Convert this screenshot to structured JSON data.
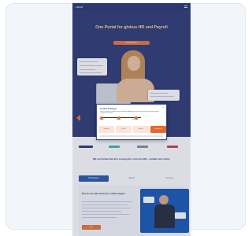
{
  "site": {
    "logo_text": "LOGO",
    "hero_title": "One Portal for globus HR und Payroll",
    "hero_cta_label": "Jetzt starten"
  },
  "modal": {
    "title": "Cookie Settings",
    "close_label": "×",
    "text": "We use cookies to improve your experience. Adjust your preferences below and choose which categories you allow.",
    "slider_labels": [
      "Essential",
      "Statistics",
      "Marketing"
    ],
    "buttons": [
      "Settings",
      "Reject",
      "Accept",
      "Accept all"
    ]
  },
  "section": {
    "title": "Mit uns finden Sie Ihre Lösung für Lohn und HR – einfach und sicher"
  },
  "tabs": [
    "HR-Software",
    "Payroll",
    "Services"
  ],
  "info": {
    "title": "Besser als alle anderen Lohnlösungen",
    "cta_label": "Mehr"
  },
  "colors": {
    "hero_bg": "#34417a",
    "accent": "#e87a3e",
    "tab_active": "#2f5fb0",
    "promo_bg": "#1f5fb7"
  }
}
